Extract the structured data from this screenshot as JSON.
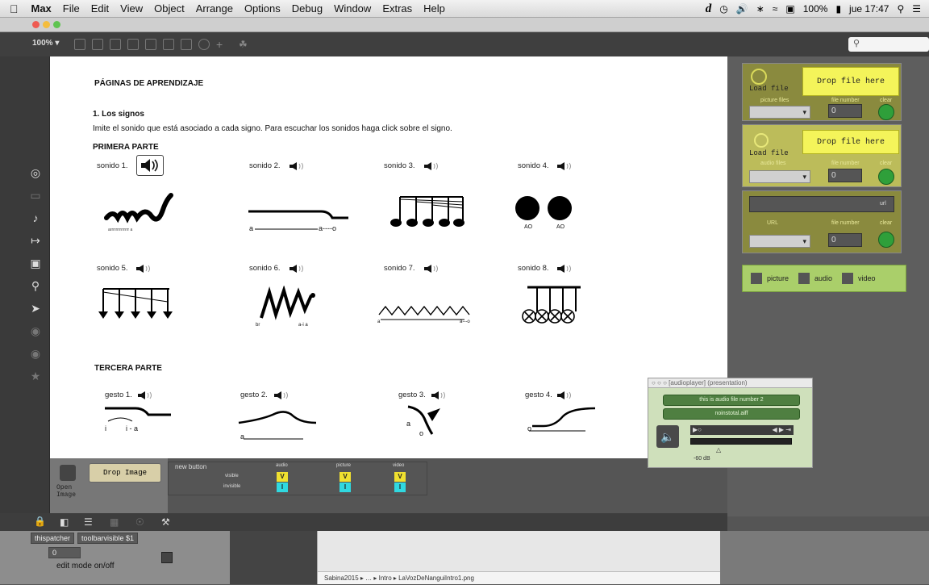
{
  "menubar": {
    "app": "Max",
    "items": [
      "File",
      "Edit",
      "View",
      "Object",
      "Arrange",
      "Options",
      "Debug",
      "Window",
      "Extras",
      "Help"
    ],
    "status": {
      "battery": "100%",
      "clock": "jue 17:47"
    }
  },
  "toolbar": {
    "zoom": "100% ▾"
  },
  "doc": {
    "title": "PÁGINAS DE APRENDIZAJE",
    "section": "1. Los signos",
    "instructions": "Imite el sonido que está asociado a cada signo.  Para escuchar los sonidos haga click sobre el signo.",
    "part1": "PRIMERA PARTE",
    "part3": "TERCERA PARTE",
    "sonidos": [
      "sonido 1.",
      "sonido 2.",
      "sonido 3.",
      "sonido 4.",
      "sonido 5.",
      "sonido 6.",
      "sonido 7.",
      "sonido 8."
    ],
    "gestos": [
      "gesto 1.",
      "gesto 2.",
      "gesto 3.",
      "gesto 4."
    ],
    "glyph_labels": {
      "s1": "arrrrrrrrrrrrrr   a",
      "s2a": "a",
      "s2b": "a----o",
      "s4a": "AO",
      "s4b": "AO",
      "s6a": "br",
      "s6b": "a-i  a",
      "s7a": "a",
      "s7b": "a---o",
      "g1a": "i",
      "g1b": "i - a",
      "g2a": "a",
      "g3a": "a",
      "g3b": "o",
      "g4a": "o"
    }
  },
  "rightpanel": {
    "load_file": "Load file",
    "drop_file": "Drop file here",
    "picture_files": "picture files",
    "audio_files": "audio files",
    "file_number": "file number",
    "clear": "clear",
    "num_value": "0",
    "url": "url",
    "url_label": "URL",
    "toggles": [
      "picture",
      "audio",
      "video"
    ]
  },
  "bottom": {
    "open_image": "Open Image",
    "drop_image": "Drop Image",
    "new_button": "new button",
    "visible": "visible",
    "invisible": "invisible",
    "cols": [
      "audio",
      "picture",
      "video"
    ],
    "v": "V",
    "i": "I"
  },
  "lower": {
    "thispatcher": "thispatcher",
    "toolbarvisible": "toolbarvisible $1",
    "num": "0",
    "edit_mode": "edit mode on/off",
    "finder_path": "Sabina2015 ▸ … ▸ Intro ▸ LaVozDeNanguiIntro1.png"
  },
  "audioplayer": {
    "title": "[audioplayer] (presentation)",
    "line1": "this is audio file number 2",
    "line2": "noinstotal.aiff",
    "db": "-60 dB"
  },
  "colors": {
    "yellow": "#f4f45a",
    "green": "#2f9f3a",
    "panel_green": "#aacf6a"
  }
}
